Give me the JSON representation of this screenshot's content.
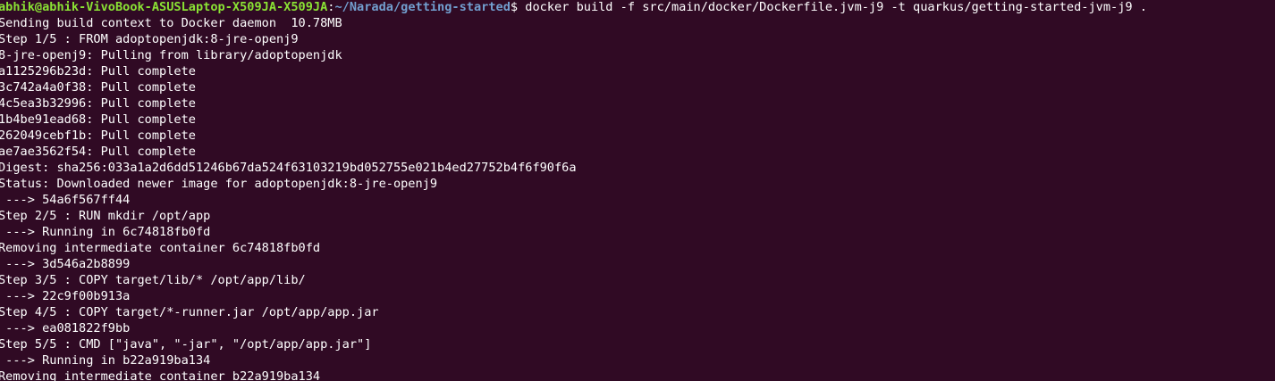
{
  "theme": {
    "background": "#300a24",
    "foreground": "#ffffff",
    "prompt_user_color": "#8ae234",
    "prompt_path_color": "#729fcf"
  },
  "prompt": {
    "user_host": "abhik@abhik-VivoBook-ASUSLaptop-X509JA-X509JA",
    "separator": ":",
    "path": "~/Narada/getting-started",
    "symbol": "$ ",
    "command": "docker build -f src/main/docker/Dockerfile.jvm-j9 -t quarkus/getting-started-jvm-j9 ."
  },
  "output_lines": [
    "Sending build context to Docker daemon  10.78MB",
    "Step 1/5 : FROM adoptopenjdk:8-jre-openj9",
    "8-jre-openj9: Pulling from library/adoptopenjdk",
    "a1125296b23d: Pull complete",
    "3c742a4a0f38: Pull complete",
    "4c5ea3b32996: Pull complete",
    "1b4be91ead68: Pull complete",
    "262049cebf1b: Pull complete",
    "ae7ae3562f54: Pull complete",
    "Digest: sha256:033a1a2d6dd51246b67da524f63103219bd052755e021b4ed27752b4f6f90f6a",
    "Status: Downloaded newer image for adoptopenjdk:8-jre-openj9",
    " ---> 54a6f567ff44",
    "Step 2/5 : RUN mkdir /opt/app",
    " ---> Running in 6c74818fb0fd",
    "Removing intermediate container 6c74818fb0fd",
    " ---> 3d546a2b8899",
    "Step 3/5 : COPY target/lib/* /opt/app/lib/",
    " ---> 22c9f00b913a",
    "Step 4/5 : COPY target/*-runner.jar /opt/app/app.jar",
    " ---> ea081822f9bb",
    "Step 5/5 : CMD [\"java\", \"-jar\", \"/opt/app/app.jar\"]",
    " ---> Running in b22a919ba134",
    "Removing intermediate container b22a919ba134"
  ]
}
